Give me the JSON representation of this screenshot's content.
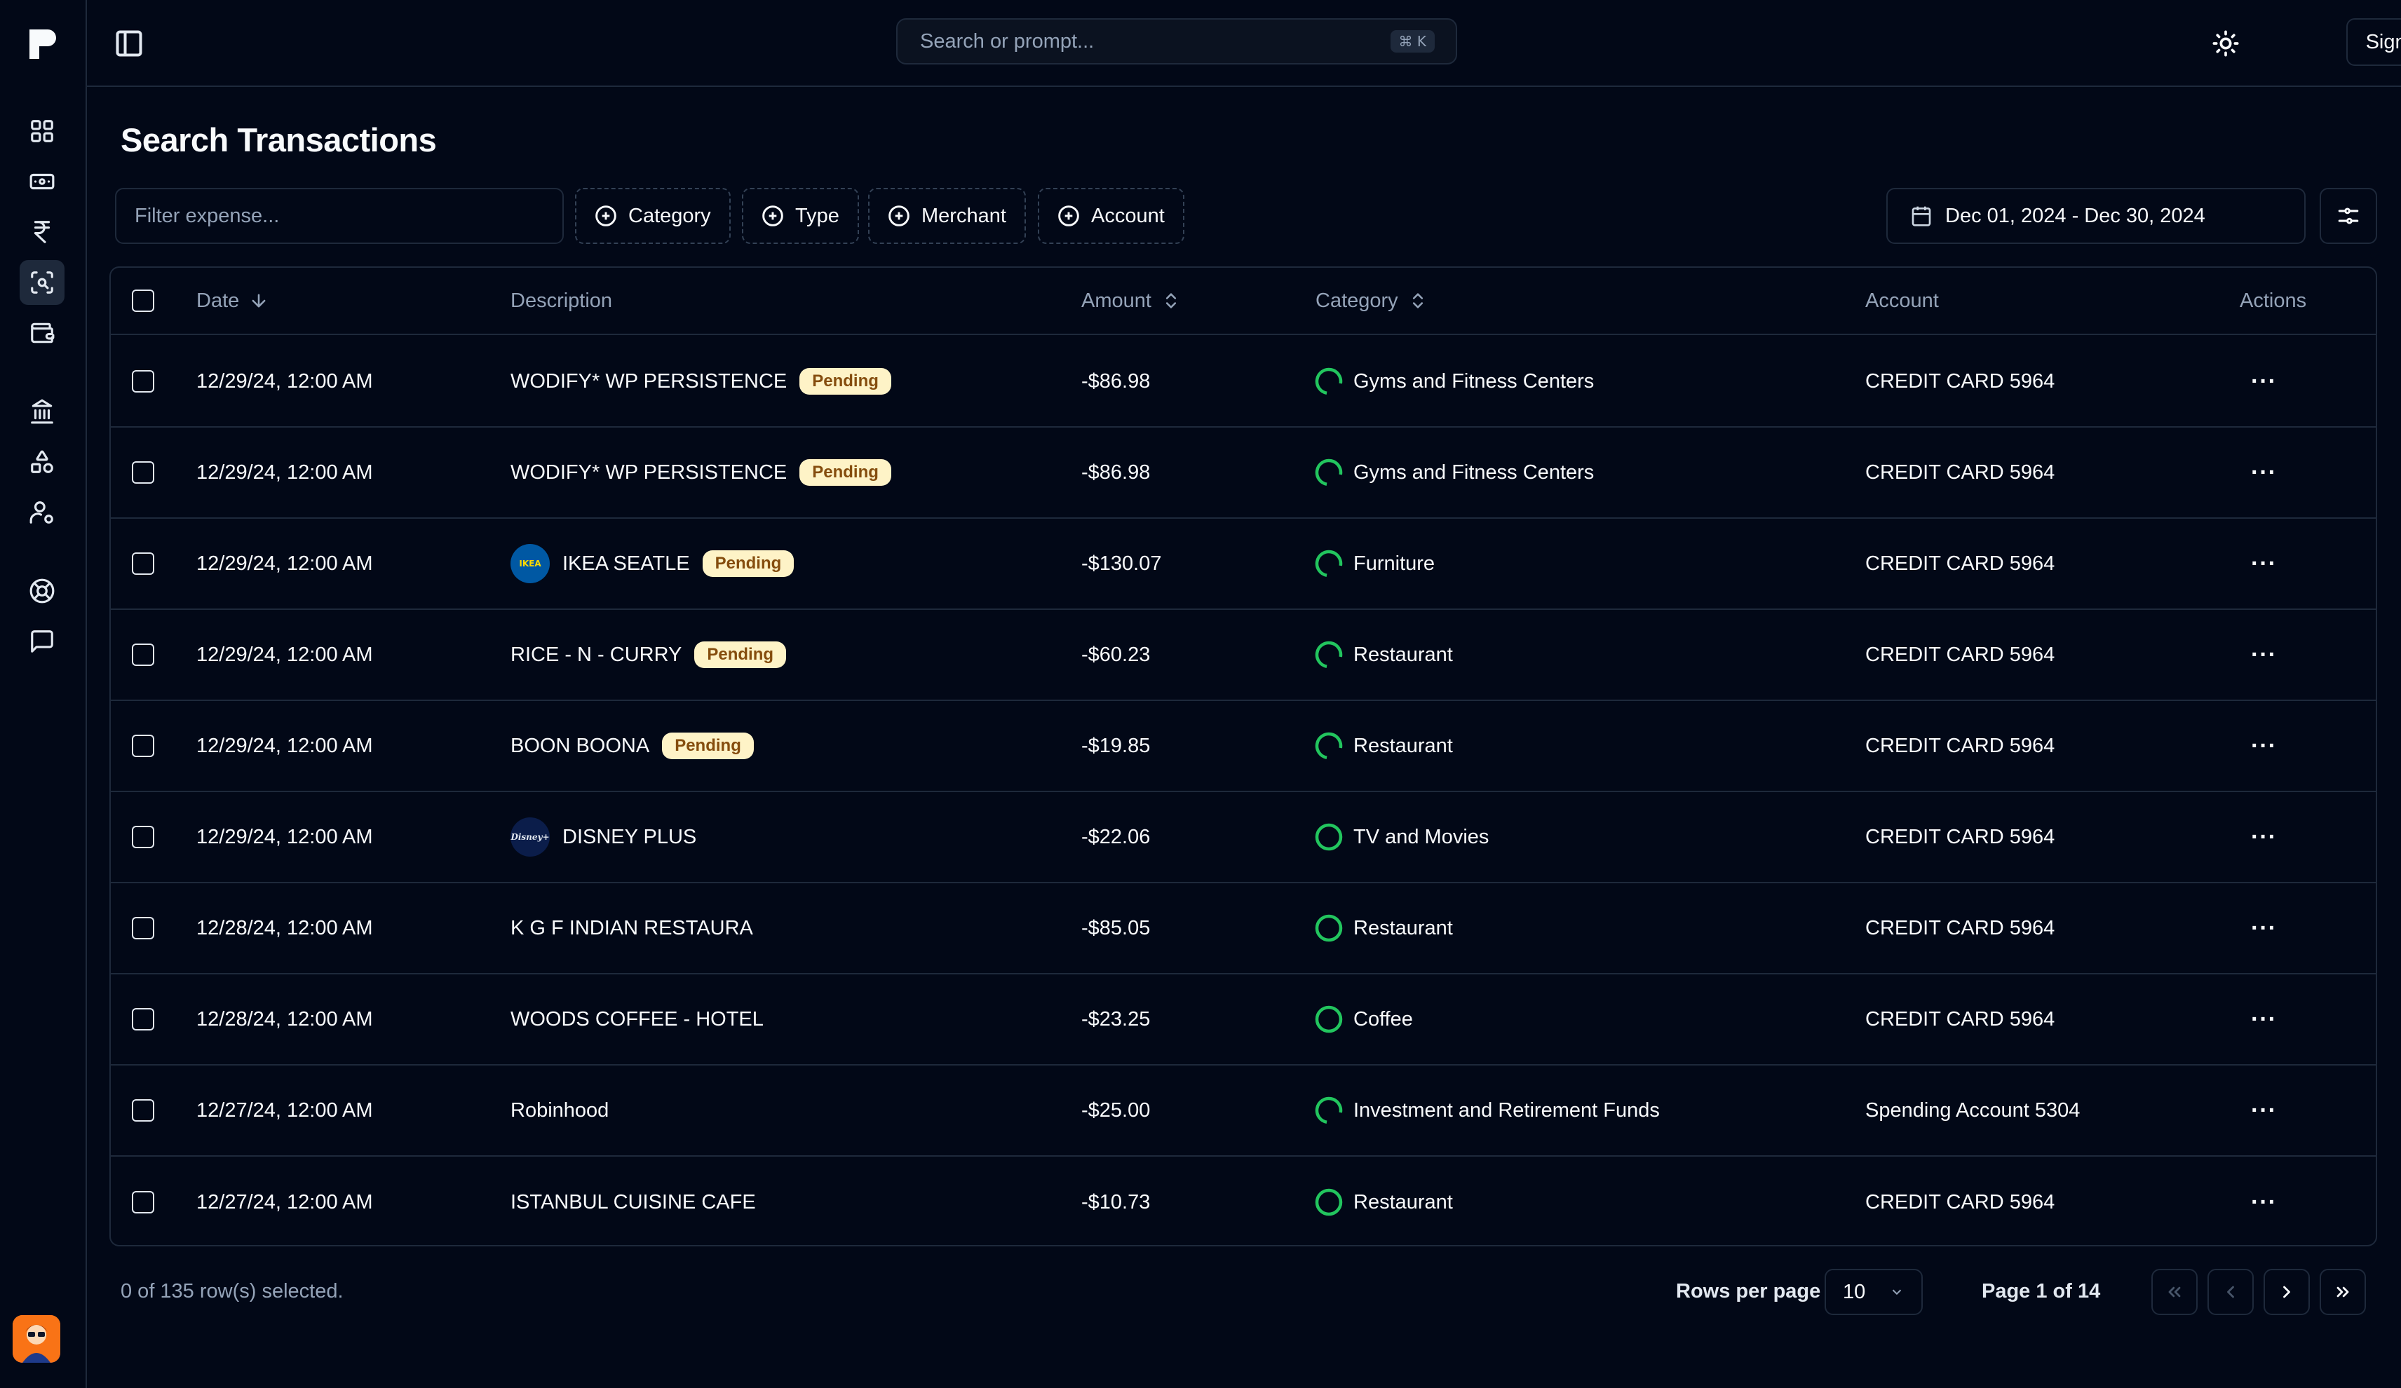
{
  "header": {
    "search_placeholder": "Search or prompt...",
    "search_shortcut": "⌘ K",
    "sign_out_label": "Sign Out"
  },
  "sidebar": {
    "items": [
      {
        "icon": "dashboard-grid-icon"
      },
      {
        "icon": "banknote-icon"
      },
      {
        "icon": "rupee-icon"
      },
      {
        "icon": "scan-search-icon",
        "active": true
      },
      {
        "icon": "wallet-icon"
      },
      {
        "icon": "bank-icon"
      },
      {
        "icon": "shapes-icon"
      },
      {
        "icon": "user-settings-icon"
      },
      {
        "icon": "lifebuoy-icon"
      },
      {
        "icon": "message-icon"
      }
    ]
  },
  "page": {
    "title": "Search Transactions"
  },
  "filters": {
    "expense_placeholder": "Filter expense...",
    "chips": [
      "Category",
      "Type",
      "Merchant",
      "Account"
    ],
    "date_range": "Dec 01, 2024 - Dec 30, 2024"
  },
  "table": {
    "columns": {
      "date": "Date",
      "description": "Description",
      "amount": "Amount",
      "category": "Category",
      "account": "Account",
      "actions": "Actions"
    },
    "pending_label": "Pending",
    "actions_glyph": "···",
    "rows": [
      {
        "date": "12/29/24, 12:00 AM",
        "description": "WODIFY* WP PERSISTENCE",
        "pending": true,
        "logo": null,
        "amount": "-$86.98",
        "category": "Gyms and Fitness Centers",
        "category_status": "partial",
        "account": "CREDIT CARD 5964"
      },
      {
        "date": "12/29/24, 12:00 AM",
        "description": "WODIFY* WP PERSISTENCE",
        "pending": true,
        "logo": null,
        "amount": "-$86.98",
        "category": "Gyms and Fitness Centers",
        "category_status": "partial",
        "account": "CREDIT CARD 5964"
      },
      {
        "date": "12/29/24, 12:00 AM",
        "description": "IKEA SEATLE",
        "pending": true,
        "logo": "ikea",
        "logo_text": "IKEA",
        "amount": "-$130.07",
        "category": "Furniture",
        "category_status": "partial",
        "account": "CREDIT CARD 5964"
      },
      {
        "date": "12/29/24, 12:00 AM",
        "description": "RICE - N - CURRY",
        "pending": true,
        "logo": null,
        "amount": "-$60.23",
        "category": "Restaurant",
        "category_status": "partial",
        "account": "CREDIT CARD 5964"
      },
      {
        "date": "12/29/24, 12:00 AM",
        "description": "BOON BOONA",
        "pending": true,
        "logo": null,
        "amount": "-$19.85",
        "category": "Restaurant",
        "category_status": "partial",
        "account": "CREDIT CARD 5964"
      },
      {
        "date": "12/29/24, 12:00 AM",
        "description": "DISNEY PLUS",
        "pending": false,
        "logo": "disney",
        "logo_text": "Disney+",
        "amount": "-$22.06",
        "category": "TV and Movies",
        "category_status": "complete",
        "account": "CREDIT CARD 5964"
      },
      {
        "date": "12/28/24, 12:00 AM",
        "description": "K G F INDIAN RESTAURA",
        "pending": false,
        "logo": null,
        "amount": "-$85.05",
        "category": "Restaurant",
        "category_status": "complete",
        "account": "CREDIT CARD 5964"
      },
      {
        "date": "12/28/24, 12:00 AM",
        "description": "WOODS COFFEE - HOTEL",
        "pending": false,
        "logo": null,
        "amount": "-$23.25",
        "category": "Coffee",
        "category_status": "complete",
        "account": "CREDIT CARD 5964"
      },
      {
        "date": "12/27/24, 12:00 AM",
        "description": "Robinhood",
        "pending": false,
        "logo": null,
        "amount": "-$25.00",
        "category": "Investment and Retirement Funds",
        "category_status": "partial",
        "account": "Spending Account 5304"
      },
      {
        "date": "12/27/24, 12:00 AM",
        "description": "ISTANBUL CUISINE CAFE",
        "pending": false,
        "logo": null,
        "amount": "-$10.73",
        "category": "Restaurant",
        "category_status": "complete",
        "account": "CREDIT CARD 5964"
      }
    ]
  },
  "footer": {
    "selected_text": "0 of 135 row(s) selected.",
    "rows_per_page_label": "Rows per page",
    "rows_per_page_value": "10",
    "page_info": "Page 1 of 14"
  },
  "colors": {
    "background": "#020817",
    "border": "#1e293b",
    "pending_bg": "#fef3c7",
    "pending_text": "#854d0e",
    "status_green": "#22c55e"
  }
}
